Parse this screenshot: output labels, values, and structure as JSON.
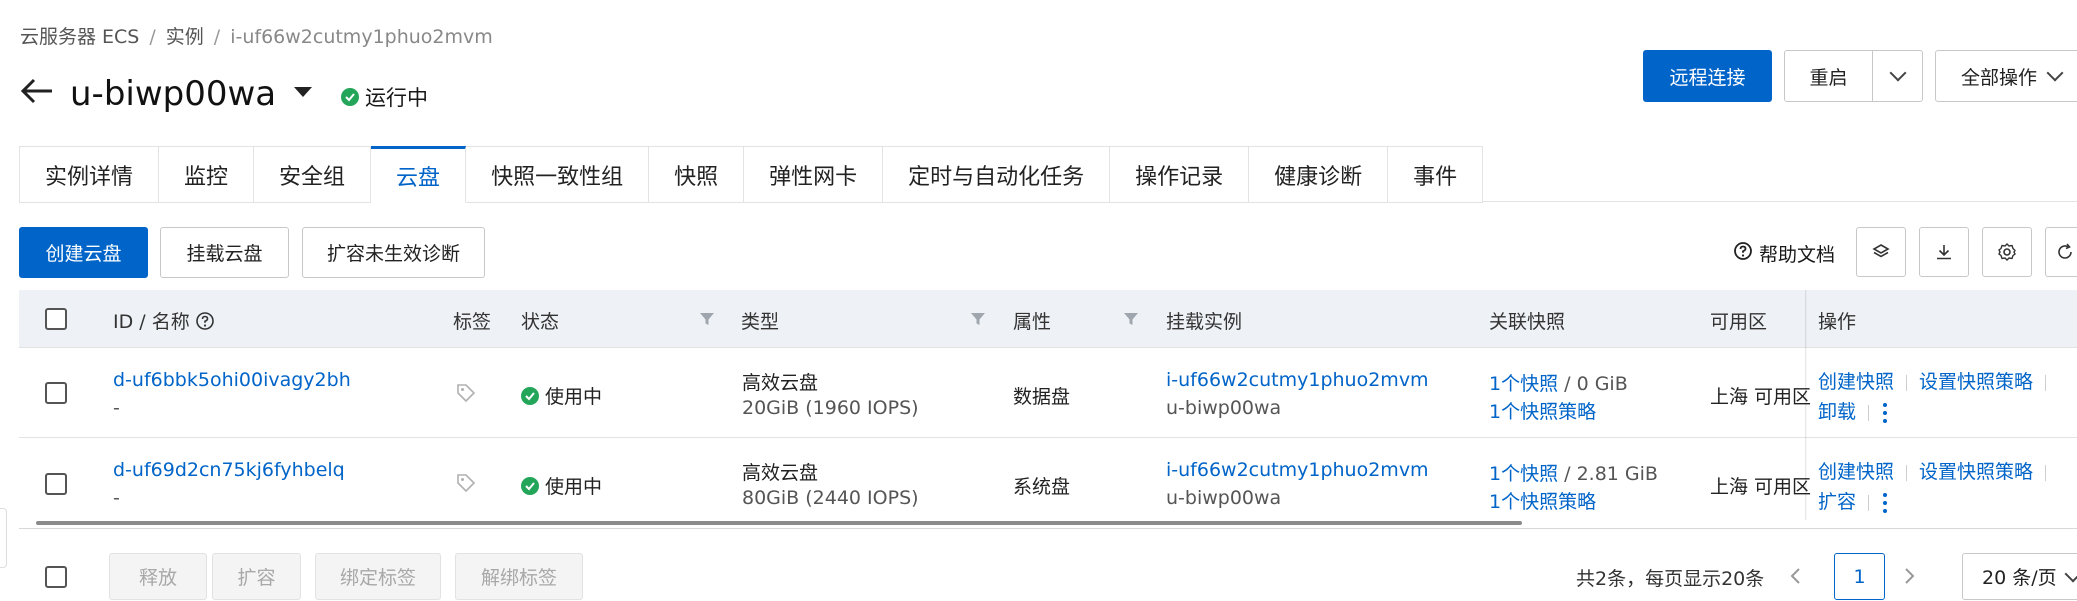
{
  "breadcrumb": {
    "items": [
      "云服务器 ECS",
      "实例",
      "i-uf66w2cutmy1phuo2mvm"
    ],
    "separator": "/"
  },
  "header": {
    "title": "u-biwp00wa",
    "status": "运行中",
    "buttons": {
      "remote": "远程连接",
      "restart": "重启",
      "all_ops": "全部操作"
    }
  },
  "tabs": [
    {
      "label": "实例详情"
    },
    {
      "label": "监控"
    },
    {
      "label": "安全组"
    },
    {
      "label": "云盘",
      "active": true
    },
    {
      "label": "快照一致性组"
    },
    {
      "label": "快照"
    },
    {
      "label": "弹性网卡"
    },
    {
      "label": "定时与自动化任务"
    },
    {
      "label": "操作记录"
    },
    {
      "label": "健康诊断"
    },
    {
      "label": "事件"
    }
  ],
  "toolbar": {
    "create": "创建云盘",
    "attach": "挂载云盘",
    "diagnose": "扩容未生效诊断",
    "help": "帮助文档"
  },
  "table": {
    "columns": {
      "id_name": "ID / 名称",
      "tags": "标签",
      "status": "状态",
      "type": "类型",
      "attribute": "属性",
      "instance": "挂载实例",
      "snapshot": "关联快照",
      "zone": "可用区",
      "ops": "操作"
    },
    "rows": [
      {
        "id": "d-uf6bbk5ohi00ivagy2bh",
        "name": "-",
        "status": "使用中",
        "type": "高效云盘",
        "spec": "20GiB (1960 IOPS)",
        "attribute": "数据盘",
        "instance_id": "i-uf66w2cutmy1phuo2mvm",
        "instance_name": "u-biwp00wa",
        "snapshot_count": "1个快照",
        "snapshot_size": " / 0 GiB",
        "snapshot_policy": "1个快照策略",
        "zone": "上海 可用区",
        "ops": {
          "create_snapshot": "创建快照",
          "set_policy": "设置快照策略",
          "extra": "卸载"
        }
      },
      {
        "id": "d-uf69d2cn75kj6fyhbelq",
        "name": "-",
        "status": "使用中",
        "type": "高效云盘",
        "spec": "80GiB (2440 IOPS)",
        "attribute": "系统盘",
        "instance_id": "i-uf66w2cutmy1phuo2mvm",
        "instance_name": "u-biwp00wa",
        "snapshot_count": "1个快照",
        "snapshot_size": " / 2.81 GiB",
        "snapshot_policy": "1个快照策略",
        "zone": "上海 可用区",
        "ops": {
          "create_snapshot": "创建快照",
          "set_policy": "设置快照策略",
          "extra": "扩容"
        }
      }
    ]
  },
  "footer": {
    "buttons": {
      "release": "释放",
      "expand": "扩容",
      "bind_tag": "绑定标签",
      "unbind_tag": "解绑标签"
    },
    "summary": "共2条，每页显示20条",
    "page": "1",
    "page_size": "20 条/页"
  },
  "colors": {
    "primary": "#0064c8",
    "success": "#23a55a",
    "header_bg": "#eef2f6"
  }
}
